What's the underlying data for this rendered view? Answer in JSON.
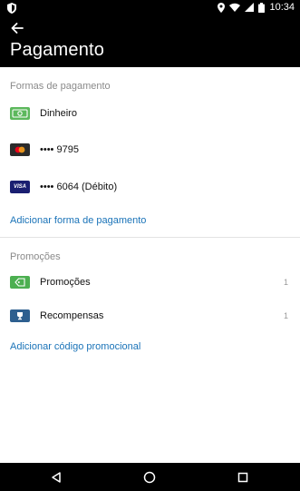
{
  "status_bar": {
    "time": "10:34",
    "icons": [
      "shield-icon",
      "location-icon",
      "wifi-icon",
      "signal-icon",
      "battery-icon"
    ]
  },
  "app_bar": {
    "title": "Pagamento",
    "back_icon": "arrow-left-icon"
  },
  "payment_section": {
    "header": "Formas de pagamento",
    "items": [
      {
        "label": "Dinheiro",
        "icon": "cash-icon"
      },
      {
        "label": "•••• 9795",
        "icon": "mastercard-icon"
      },
      {
        "label": "•••• 6064 (Débito)",
        "icon": "visa-icon",
        "brand": "VISA"
      }
    ],
    "add_link": "Adicionar forma de pagamento"
  },
  "promo_section": {
    "header": "Promoções",
    "items": [
      {
        "label": "Promoções",
        "icon": "tag-icon",
        "count": "1"
      },
      {
        "label": "Recompensas",
        "icon": "trophy-icon",
        "count": "1"
      }
    ],
    "add_link": "Adicionar código promocional"
  },
  "nav_bar": {
    "icons": [
      "back-triangle-icon",
      "home-circle-icon",
      "recents-square-icon"
    ]
  },
  "colors": {
    "link": "#1a73b8",
    "cash_green": "#5cb85c",
    "promo_green": "#4caf50",
    "reward_blue": "#2d5f8f",
    "visa_blue": "#1a1f71"
  }
}
